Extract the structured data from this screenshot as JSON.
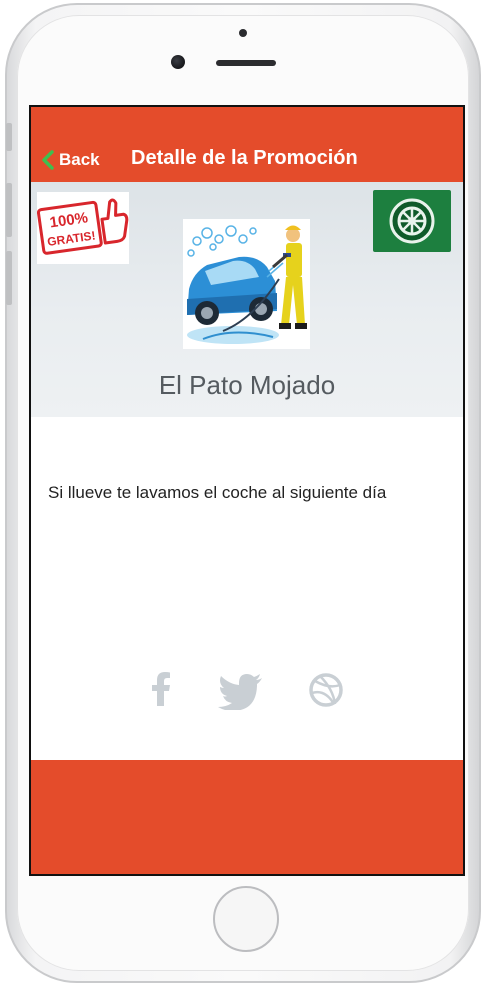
{
  "navbar": {
    "back_label": "Back",
    "title": "Detalle de la Promoción",
    "color": "#e44c2b"
  },
  "hero": {
    "gratis_badge_text_top": "100%",
    "gratis_badge_text_bottom": "GRATIS!",
    "business_name": "El Pato Mojado",
    "wheel_badge_color": "#1d7f3f"
  },
  "content": {
    "description": "Si llueve te lavamos el coche al siguiente día"
  },
  "social": {
    "icons": [
      "facebook-icon",
      "twitter-icon",
      "dribbble-icon"
    ],
    "color": "#c9cfd4"
  }
}
